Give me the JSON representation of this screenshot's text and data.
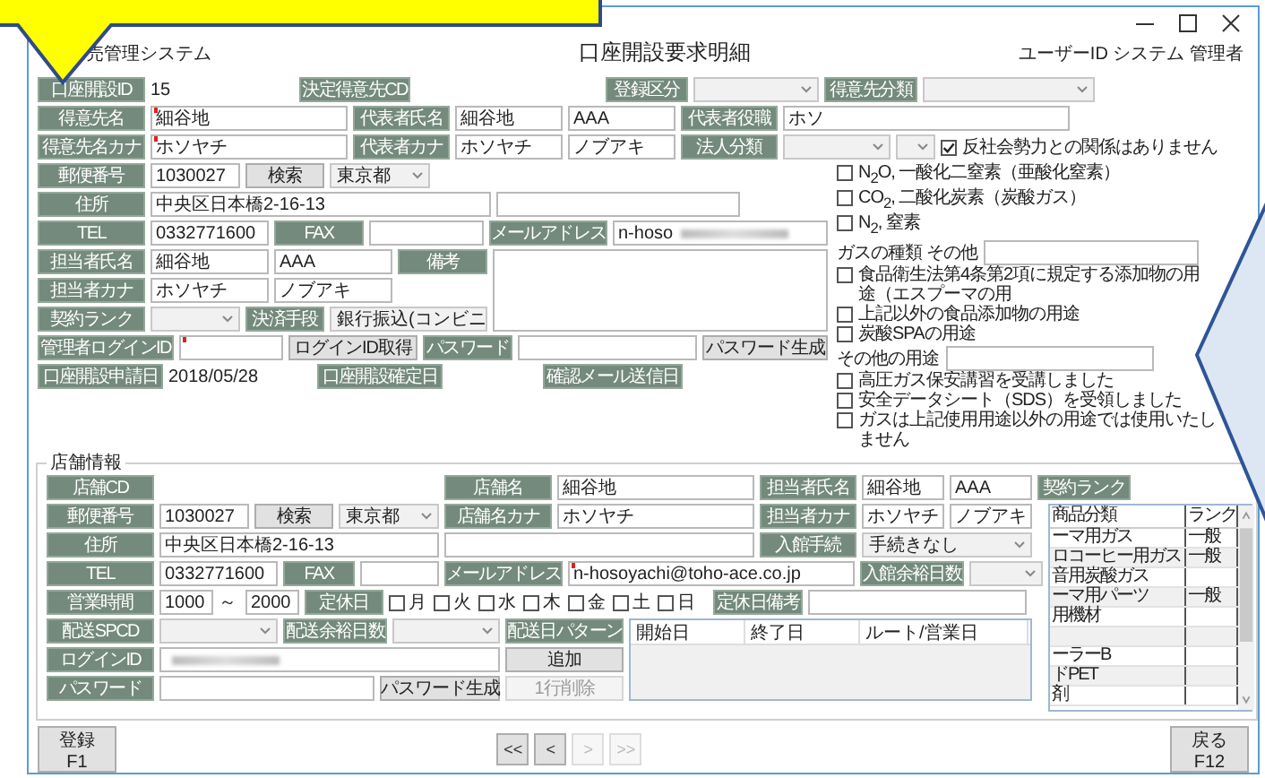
{
  "window": {
    "app_name": "売管理システム",
    "title": "口座開設要求明細",
    "user": "ユーザーID システム 管理者"
  },
  "account": {
    "account_id": {
      "label": "口座開設ID",
      "value": "15"
    },
    "decided_cd": {
      "label": "決定得意先CD"
    },
    "registration_type": {
      "label": "登録区分"
    },
    "customer_class": {
      "label": "得意先分類"
    },
    "customer_name": {
      "label": "得意先名",
      "value": "細谷地",
      "required": true
    },
    "rep_name": {
      "label": "代表者氏名",
      "last": "細谷地",
      "first": "AAA"
    },
    "rep_title": {
      "label": "代表者役職",
      "value": "ホソ"
    },
    "customer_kana": {
      "label": "得意先名カナ",
      "value": "ホソヤチ",
      "required": true
    },
    "rep_kana": {
      "label": "代表者カナ",
      "last": "ホソヤチ",
      "first": "ノブアキ"
    },
    "corporate_class": {
      "label": "法人分類"
    },
    "no_antisocial": {
      "label": "反社会勢力との関係はありません",
      "checked": true
    },
    "postal": {
      "label": "郵便番号",
      "value": "1030027",
      "search": "検索",
      "prefecture": "東京都"
    },
    "address": {
      "label": "住所",
      "value": "中央区日本橋2-16-13"
    },
    "tel": {
      "label": "TEL",
      "value": "0332771600"
    },
    "fax": {
      "label": "FAX"
    },
    "email": {
      "label": "メールアドレス",
      "value": "n-hoso"
    },
    "contact_name": {
      "label": "担当者氏名",
      "last": "細谷地",
      "first": "AAA"
    },
    "remarks": {
      "label": "備考"
    },
    "contact_kana": {
      "label": "担当者カナ",
      "last": "ホソヤチ",
      "first": "ノブアキ"
    },
    "contract_rank": {
      "label": "契約ランク"
    },
    "payment": {
      "label": "決済手段",
      "value": "銀行振込(コンビニ"
    },
    "admin_login": {
      "label": "管理者ログインID",
      "required": true,
      "button": "ログインID取得"
    },
    "password": {
      "label": "パスワード",
      "button": "パスワード生成"
    },
    "applied": {
      "label": "口座開設申請日",
      "value": "2018/05/28"
    },
    "confirmed": {
      "label": "口座開設確定日"
    },
    "mail_sent": {
      "label": "確認メール送信日"
    }
  },
  "gas_types": [
    {
      "label": "N$_{2}$O, 一酸化二窒素（亜酸化窒素）",
      "checked": false
    },
    {
      "label": "CO$_{2}$, 二酸化炭素（炭酸ガス）",
      "checked": false
    },
    {
      "label": "N$_{2}$, 窒素",
      "checked": false
    }
  ],
  "gas_other": {
    "label": "ガスの種類 その他"
  },
  "uses": [
    {
      "label": "食品衛生法第4条第2項に規定する添加物の用途（エスプーマの用",
      "checked": false
    },
    {
      "label": "上記以外の食品添加物の用途",
      "checked": false
    },
    {
      "label": "炭酸SPAの用途",
      "checked": false
    }
  ],
  "use_other": {
    "label": "その他の用途"
  },
  "agreements": [
    {
      "label": "高圧ガス保安講習を受講しました",
      "checked": false
    },
    {
      "label": "安全データシート（SDS）を受領しました",
      "checked": false
    },
    {
      "label": "ガスは上記使用用途以外の用途では使用いたしません",
      "checked": false
    }
  ],
  "store": {
    "legend": "店舗情報",
    "store_cd": {
      "label": "店舗CD"
    },
    "store_name": {
      "label": "店舗名",
      "value": "細谷地"
    },
    "contact_name": {
      "label": "担当者氏名",
      "last": "細谷地",
      "first": "AAA"
    },
    "contract_rank": {
      "label": "契約ランク"
    },
    "postal": {
      "label": "郵便番号",
      "value": "1030027",
      "search": "検索",
      "prefecture": "東京都"
    },
    "store_kana": {
      "label": "店舗名カナ",
      "value": "ホソヤチ"
    },
    "contact_kana": {
      "label": "担当者カナ",
      "last": "ホソヤチ",
      "first": "ノブアキ"
    },
    "address": {
      "label": "住所",
      "value": "中央区日本橋2-16-13"
    },
    "entry_procedure": {
      "label": "入館手続",
      "value": "手続きなし"
    },
    "tel": {
      "label": "TEL",
      "value": "0332771600"
    },
    "fax": {
      "label": "FAX"
    },
    "email": {
      "label": "メールアドレス",
      "value": "n-hosoyachi@toho-ace.co.jp",
      "required": true
    },
    "entry_days": {
      "label": "入館余裕日数"
    },
    "hours": {
      "label": "営業時間",
      "from": "1000",
      "separator": "～",
      "to": "2000"
    },
    "holiday": {
      "label": "定休日",
      "days": [
        {
          "label": "月",
          "checked": false
        },
        {
          "label": "火",
          "checked": false
        },
        {
          "label": "水",
          "checked": false
        },
        {
          "label": "木",
          "checked": false
        },
        {
          "label": "金",
          "checked": false
        },
        {
          "label": "土",
          "checked": false
        },
        {
          "label": "日",
          "checked": false
        }
      ]
    },
    "holiday_note": {
      "label": "定休日備考"
    },
    "delivery_spcd": {
      "label": "配送SPCD"
    },
    "delivery_days": {
      "label": "配送余裕日数"
    },
    "delivery_pattern": {
      "label": "配送日パターン",
      "columns": [
        "開始日",
        "終了日",
        "ルート/営業日"
      ]
    },
    "login_id": {
      "label": "ログインID"
    },
    "add_button": "追加",
    "password": {
      "label": "パスワード",
      "button": "パスワード生成"
    },
    "delete_row": {
      "label": "1行削除",
      "disabled": true
    },
    "products": {
      "columns": [
        "商品分類",
        "ランク"
      ],
      "rows": [
        {
          "category": "ーマ用ガス",
          "rank": "一般"
        },
        {
          "category": "ロコーヒー用ガス",
          "rank": "一般"
        },
        {
          "category": "音用炭酸ガス",
          "rank": ""
        },
        {
          "category": "ーマ用パーツ",
          "rank": "一般"
        },
        {
          "category": "用機材",
          "rank": ""
        },
        {
          "category": "",
          "rank": ""
        },
        {
          "category": "ーラーB",
          "rank": ""
        },
        {
          "category": "ドPET",
          "rank": ""
        },
        {
          "category": "剤",
          "rank": ""
        }
      ]
    }
  },
  "footer": {
    "register": {
      "label": "登録",
      "key": "F1"
    },
    "nav": [
      {
        "label": "<<",
        "disabled": false
      },
      {
        "label": "<",
        "disabled": false
      },
      {
        "label": ">",
        "disabled": true
      },
      {
        "label": ">>",
        "disabled": true
      }
    ],
    "back": {
      "label": "戻る",
      "key": "F12"
    }
  }
}
